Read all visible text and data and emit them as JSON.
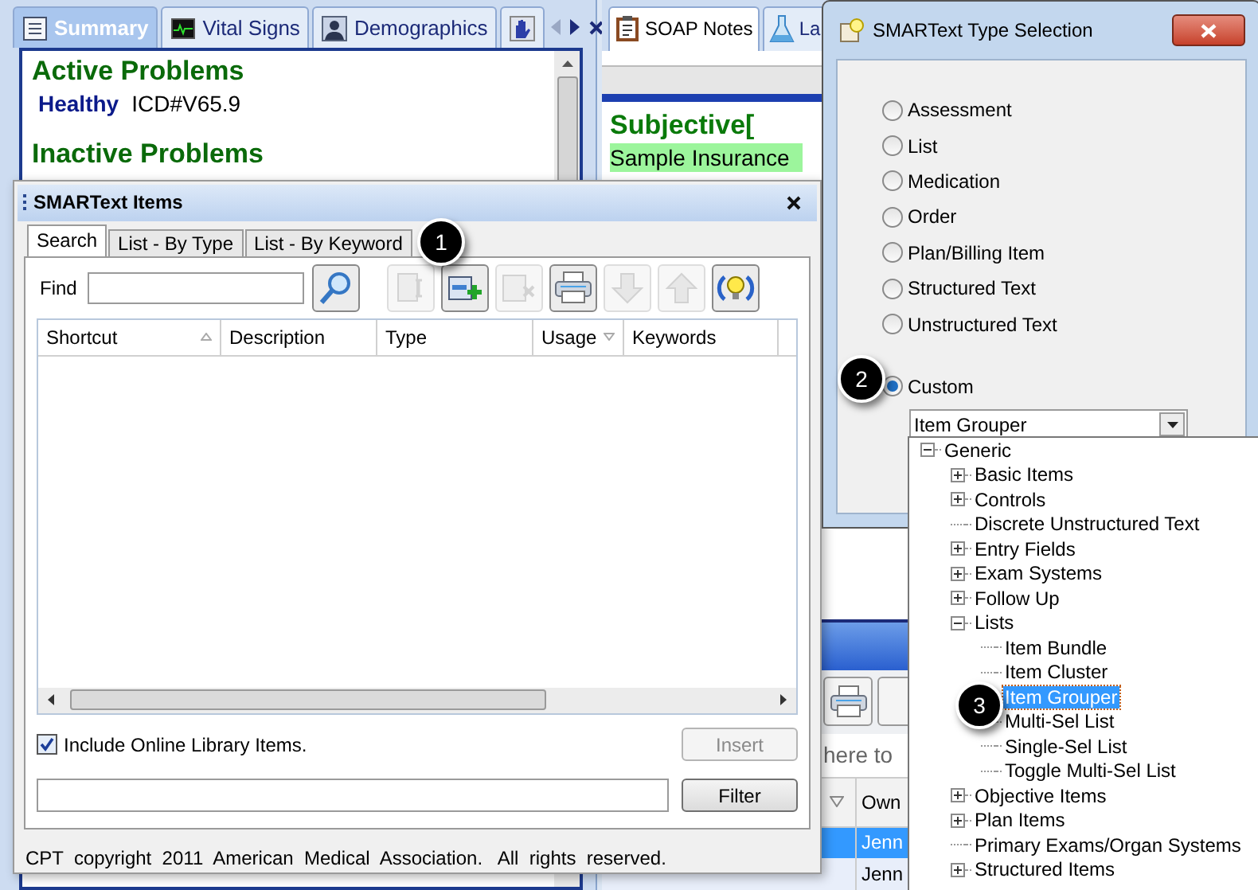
{
  "summary_panel": {
    "tabs": [
      {
        "label": "Summary",
        "selected": true,
        "kind": "list"
      },
      {
        "label": "Vital Signs",
        "selected": false,
        "kind": "monitor"
      },
      {
        "label": "Demographics",
        "selected": false,
        "kind": "person"
      },
      {
        "selected": false,
        "kind": "hand"
      }
    ],
    "active_heading": "Active Problems",
    "active_items": [
      {
        "name": "Healthy",
        "code": "ICD#V65.9"
      }
    ],
    "inactive_heading": "Inactive Problems"
  },
  "soap_panel": {
    "tabs": [
      {
        "label": "SOAP Notes",
        "selected": true,
        "kind": "clipboard"
      },
      {
        "label": "La",
        "selected": false,
        "kind": "flask"
      }
    ],
    "heading": "Subjective[",
    "line": "Sample Insurance",
    "search_hint": "here to",
    "column": "Own",
    "rows": [
      {
        "owner": "Jenn",
        "selected": true
      },
      {
        "owner": "Jenn",
        "selected": false
      }
    ]
  },
  "smartext_items": {
    "title": "SMARText Items",
    "tabs": [
      {
        "label": "Search",
        "selected": true
      },
      {
        "label": "List - By Type",
        "selected": false
      },
      {
        "label": "List - By Keyword",
        "selected": false
      }
    ],
    "find_label": "Find",
    "toolbar": [
      {
        "kind": "edit",
        "disabled": true
      },
      {
        "kind": "add",
        "disabled": false
      },
      {
        "kind": "delete",
        "disabled": true
      },
      {
        "kind": "print",
        "disabled": false
      },
      {
        "kind": "down",
        "disabled": true
      },
      {
        "kind": "up",
        "disabled": true
      },
      {
        "kind": "bulb",
        "disabled": false
      }
    ],
    "columns": [
      {
        "label": "Shortcut",
        "sorted": true,
        "descending": false
      },
      {
        "label": "Description",
        "sorted": false
      },
      {
        "label": "Type",
        "sorted": false
      },
      {
        "label": "Usage",
        "sorted": true,
        "descending": true
      },
      {
        "label": "Keywords",
        "sorted": false
      }
    ],
    "include_online": {
      "label": "Include Online Library Items.",
      "checked": true
    },
    "insert_button": {
      "label": "Insert",
      "disabled": true
    },
    "filter_button": {
      "label": "Filter",
      "disabled": false
    },
    "copyright": "CPT  copyright  2011  American  Medical  Association.   All  rights  reserved."
  },
  "type_selection": {
    "title": "SMARText Type Selection",
    "options": [
      {
        "label": "Assessment",
        "selected": false
      },
      {
        "label": "List",
        "selected": false
      },
      {
        "label": "Medication",
        "selected": false
      },
      {
        "label": "Order",
        "selected": false
      },
      {
        "label": "Plan/Billing Item",
        "selected": false
      },
      {
        "label": "Structured Text",
        "selected": false
      },
      {
        "label": "Unstructured Text",
        "selected": false
      },
      {
        "label": "Custom",
        "selected": true
      }
    ],
    "custom_value": "Item Grouper"
  },
  "type_tree": {
    "items": [
      {
        "label": "Generic",
        "expanded": true,
        "selected": false,
        "children": [
          {
            "label": "Basic Items",
            "expanded": false,
            "selected": false
          },
          {
            "label": "Controls",
            "expanded": false,
            "selected": false
          },
          {
            "label": "Discrete Unstructured Text",
            "selected": false
          },
          {
            "label": "Entry Fields",
            "expanded": false,
            "selected": false
          },
          {
            "label": "Exam Systems",
            "expanded": false,
            "selected": false
          },
          {
            "label": "Follow Up",
            "expanded": false,
            "selected": false
          },
          {
            "label": "Lists",
            "expanded": true,
            "selected": false,
            "children": [
              {
                "label": "Item Bundle",
                "selected": false
              },
              {
                "label": "Item Cluster",
                "selected": false
              },
              {
                "label": "Item Grouper",
                "selected": true
              },
              {
                "label": "Multi-Sel List",
                "selected": false
              },
              {
                "label": "Single-Sel List",
                "selected": false
              },
              {
                "label": "Toggle Multi-Sel List",
                "selected": false
              }
            ]
          },
          {
            "label": "Objective Items",
            "expanded": false,
            "selected": false
          },
          {
            "label": "Plan Items",
            "expanded": false,
            "selected": false
          },
          {
            "label": "Primary Exams/Organ Systems",
            "selected": false
          },
          {
            "label": "Structured Items",
            "expanded": false,
            "selected": false
          }
        ]
      }
    ]
  },
  "callouts": [
    {
      "label": "1"
    },
    {
      "label": "2"
    },
    {
      "label": "3"
    }
  ]
}
